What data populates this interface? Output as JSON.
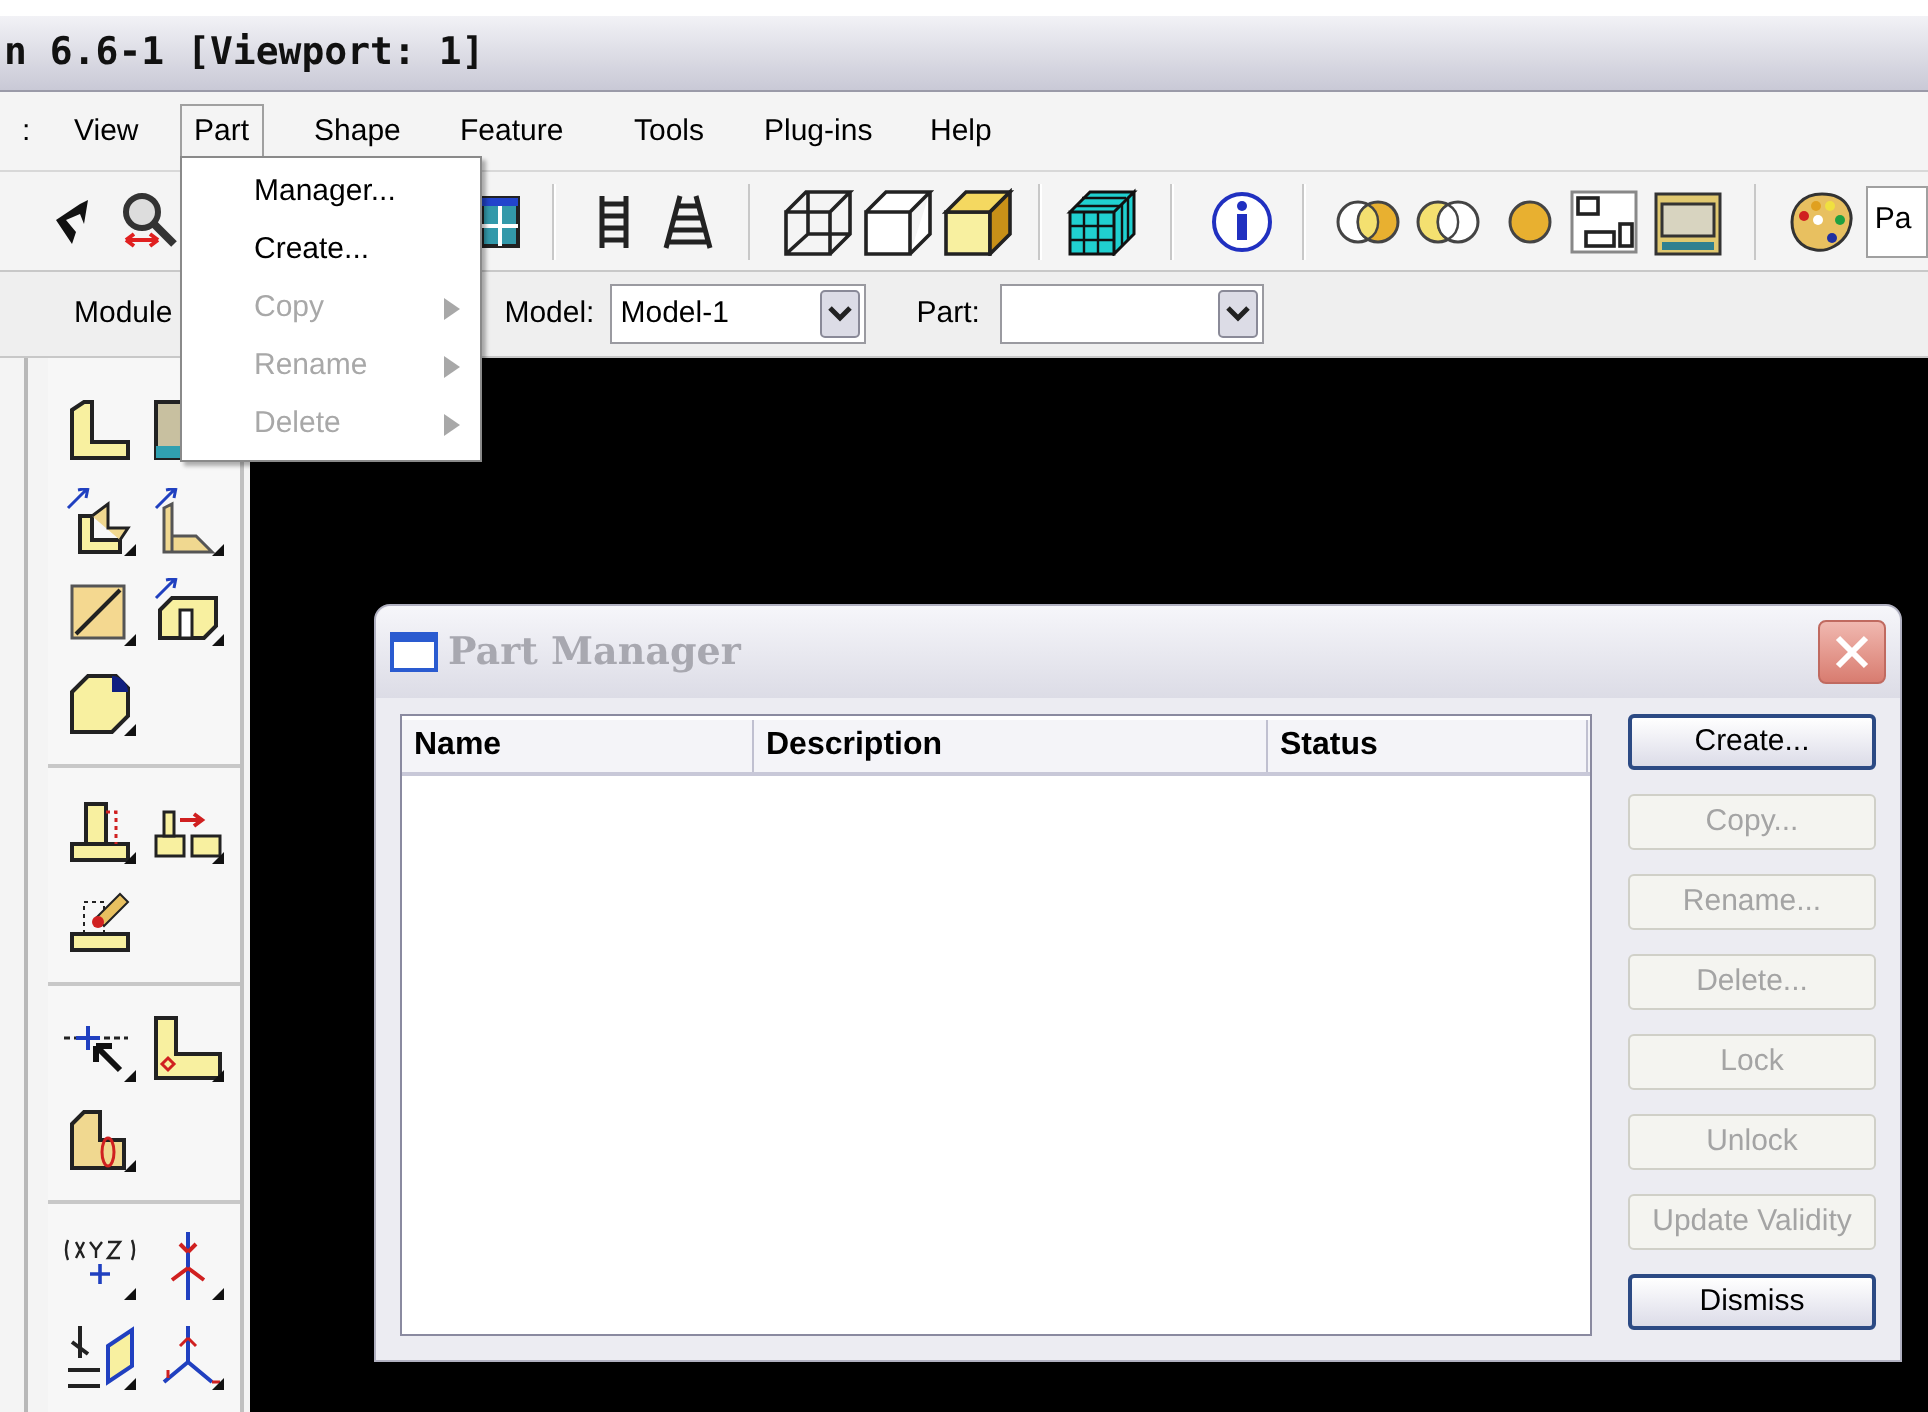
{
  "window": {
    "title": "n 6.6-1 [Viewport: 1]"
  },
  "menu_bar": [
    {
      "label": ":",
      "selected": false
    },
    {
      "label": "View",
      "selected": false
    },
    {
      "label": "Part",
      "selected": true
    },
    {
      "label": "Shape",
      "selected": false
    },
    {
      "label": "Feature",
      "selected": false
    },
    {
      "label": "Tools",
      "selected": false
    },
    {
      "label": "Plug-ins",
      "selected": false
    },
    {
      "label": "Help",
      "selected": false
    }
  ],
  "part_menu": [
    {
      "label": "Manager...",
      "disabled": false,
      "submenu": false
    },
    {
      "label": "Create...",
      "disabled": false,
      "submenu": false
    },
    {
      "label": "Copy",
      "disabled": true,
      "submenu": true
    },
    {
      "label": "Rename",
      "disabled": true,
      "submenu": true
    },
    {
      "label": "Delete",
      "disabled": true,
      "submenu": true
    }
  ],
  "toolbar": {
    "field_value": "Pa"
  },
  "context_bar": {
    "module_label": "Module",
    "model_label": "Model:",
    "model_value": "Model-1",
    "part_label": "Part:"
  },
  "part_manager": {
    "title": "Part Manager",
    "columns": [
      "Name",
      "Description",
      "Status"
    ],
    "buttons": [
      {
        "label": "Create...",
        "disabled": false
      },
      {
        "label": "Copy...",
        "disabled": true
      },
      {
        "label": "Rename...",
        "disabled": true
      },
      {
        "label": "Delete...",
        "disabled": true
      },
      {
        "label": "Lock",
        "disabled": true
      },
      {
        "label": "Unlock",
        "disabled": true
      },
      {
        "label": "Update Validity",
        "disabled": true
      },
      {
        "label": "Dismiss",
        "disabled": false
      }
    ]
  }
}
